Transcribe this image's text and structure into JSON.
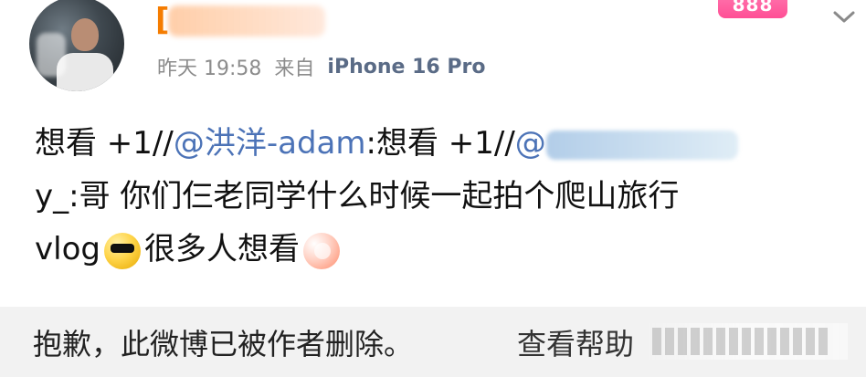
{
  "post": {
    "username": "[",
    "vip_badge": "888",
    "time": "昨天 19:58",
    "from_label": "来自",
    "device": "iPhone 16 Pro",
    "content": {
      "line1_part1": "想看 +1//",
      "mention1": "@洪洋-adam",
      "line1_part2": ":想看 +1//",
      "mention2": "@",
      "line2_prefix": "y_:哥 你们仨老同学什么时候一起拍个爬山旅行",
      "line3_text": "vlog",
      "line3_suffix": "很多人想看"
    }
  },
  "deleted_notice": {
    "text": "抱歉，此微博已被作者删除。",
    "help": "查看帮助"
  },
  "icons": {
    "more": "chevron-down-icon",
    "emoji_sunglasses": "sunglasses-emoji-icon",
    "emoji_fan": "fan-emoji-icon"
  },
  "colors": {
    "username": "#f57c00",
    "mention": "#4c73b7",
    "meta": "#8c8c8c",
    "deleted_bar_bg": "#f2f2f2"
  }
}
